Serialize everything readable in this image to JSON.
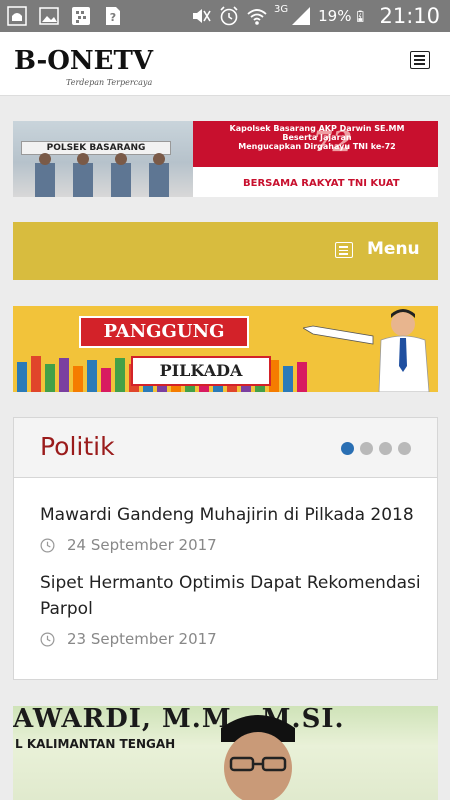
{
  "status_bar": {
    "time": "21:10",
    "battery": "19%",
    "network": "3G"
  },
  "header": {
    "logo_text": "B-ONETV",
    "logo_tagline": "Terdepan Terpercaya"
  },
  "banner_top": {
    "sign_text": "POLSEK BASARANG",
    "line1": "Kapolsek Basarang AKP Darwin SE.MM",
    "line2": "Beserta Jajaran",
    "line3": "Mengucapkan Dirgahayu TNI ke-72",
    "number": "72",
    "bottom_text": "BERSAMA RAKYAT TNI KUAT"
  },
  "menu": {
    "label": "Menu"
  },
  "banner_pilkada": {
    "line1": "PANGGUNG",
    "line2": "PILKADA"
  },
  "politik": {
    "title": "Politik",
    "articles": [
      {
        "title": "Mawardi Gandeng Muhajirin di Pilkada 2018",
        "date": "24 September 2017"
      },
      {
        "title": "Sipet Hermanto Optimis Dapat Rekomendasi Parpol",
        "date": "23 September 2017"
      }
    ]
  },
  "bottom_banner": {
    "line1": "AWARDI, M.M., M.SI.",
    "line2": "L KALIMANTAN TENGAH"
  },
  "colors": {
    "accent_gold": "#d8bc3e",
    "politik_title": "#9a1b1b",
    "active_dot": "#2a6fb3"
  }
}
